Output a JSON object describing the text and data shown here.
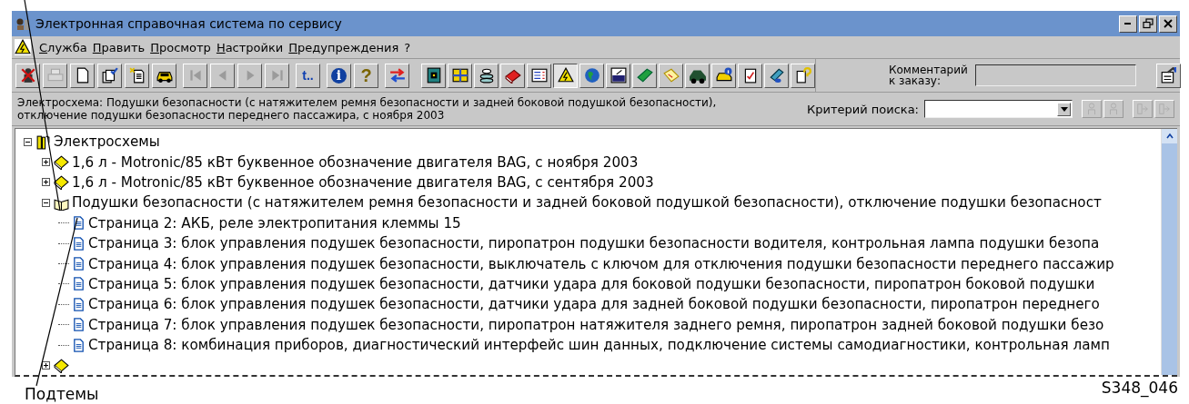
{
  "window": {
    "title": "Электронная справочная система по сервису"
  },
  "menu": [
    {
      "label": "Служба",
      "underline": true
    },
    {
      "label": "Править",
      "underline": true
    },
    {
      "label": "Просмотр",
      "underline": true
    },
    {
      "label": "Настройки",
      "underline": true
    },
    {
      "label": "Предупреждения",
      "underline": true
    },
    {
      "label": "?",
      "underline": false
    }
  ],
  "toolbar": [
    {
      "buttons": [
        {
          "disabled": false
        },
        {
          "disabled": true
        },
        {
          "disabled": false
        },
        {
          "disabled": false
        },
        {
          "disabled": false
        },
        {
          "disabled": false
        }
      ]
    },
    {
      "buttons": [
        {
          "disabled": true
        },
        {
          "disabled": true
        },
        {
          "disabled": true
        },
        {
          "disabled": true
        }
      ]
    },
    {
      "buttons": [
        {
          "glyph": "t..",
          "disabled": false
        }
      ]
    },
    {
      "buttons": [
        {
          "glyph": "i",
          "disabled": false
        },
        {
          "glyph": "?",
          "disabled": false
        }
      ]
    },
    {
      "buttons": [
        {
          "disabled": false
        }
      ]
    },
    {
      "buttons": [
        {
          "disabled": false,
          "selected": false
        },
        {
          "disabled": false,
          "selected": false
        },
        {
          "disabled": false,
          "selected": false
        },
        {
          "disabled": false,
          "selected": false
        },
        {
          "disabled": false,
          "selected": false
        },
        {
          "disabled": false,
          "selected": true
        },
        {
          "disabled": false,
          "selected": false
        },
        {
          "disabled": false,
          "selected": false
        },
        {
          "disabled": false,
          "selected": false
        },
        {
          "disabled": false,
          "selected": false
        },
        {
          "disabled": false,
          "selected": false
        },
        {
          "disabled": false,
          "selected": false
        },
        {
          "disabled": false,
          "selected": false
        },
        {
          "disabled": false,
          "selected": false
        },
        {
          "disabled": false,
          "selected": false
        }
      ]
    }
  ],
  "order_comment": {
    "label": "Комментарий\nк заказу:"
  },
  "info": "Электросхема: Подушки безопасности (с натяжителем ремня безопасности и задней боковой подушкой безопасности),\nотключение подушки безопасности переднего пассажира, с ноября 2003",
  "search": {
    "label": "Критерий поиска:",
    "buttons": [
      {
        "disabled": true
      },
      {
        "disabled": true
      },
      {
        "disabled": true
      },
      {
        "disabled": true
      }
    ]
  },
  "tree": {
    "label": "Электросхемы",
    "kind": "folder",
    "expanded": true,
    "children": [
      {
        "label": "1,6 л - Motronic/85 кВт буквенное обозначение двигателя BAG, с ноября 2003",
        "kind": "book",
        "expanded": false
      },
      {
        "label": "1,6 л - Motronic/85 кВт буквенное обозначение двигателя BAG, с сентября 2003",
        "kind": "book",
        "expanded": false
      },
      {
        "label": "Подушки безопасности (с натяжителем ремня безопасности и задней боковой подушкой безопасности), отключение подушки безопасност",
        "kind": "open-book",
        "expanded": true,
        "children": [
          {
            "label": "Страница 2: АКБ, реле электропитания клеммы 15",
            "kind": "page"
          },
          {
            "label": "Страница 3: блок управления подушек безопасности, пиропатрон подушки безопасности водителя, контрольная лампа подушки безопа",
            "kind": "page"
          },
          {
            "label": "Страница 4: блок управления подушек безопасности, выключатель с ключом для отключения подушки безопасности переднего пассажир",
            "kind": "page"
          },
          {
            "label": "Страница 5: блок управления подушек безопасности, датчики удара для боковой подушки безопасности, пиропатрон боковой подушки",
            "kind": "page"
          },
          {
            "label": "Страница 6: блок управления подушек безопасности, датчики удара для задней боковой подушки безопасности, пиропатрон переднего",
            "kind": "page"
          },
          {
            "label": "Страница 7: блок управления подушек безопасности, пиропатрон натяжителя заднего ремня, пиропатрон задней боковой подушки безо",
            "kind": "page"
          },
          {
            "label": "Страница 8: комбинация приборов, диагностический интерфейс шин данных, подключение системы самодиагностики, контрольная ламп",
            "kind": "page"
          }
        ]
      },
      {
        "kind": "book",
        "expanded": false
      }
    ]
  },
  "annotations": {
    "callout": "Подтемы",
    "figure_code": "S348_046"
  }
}
